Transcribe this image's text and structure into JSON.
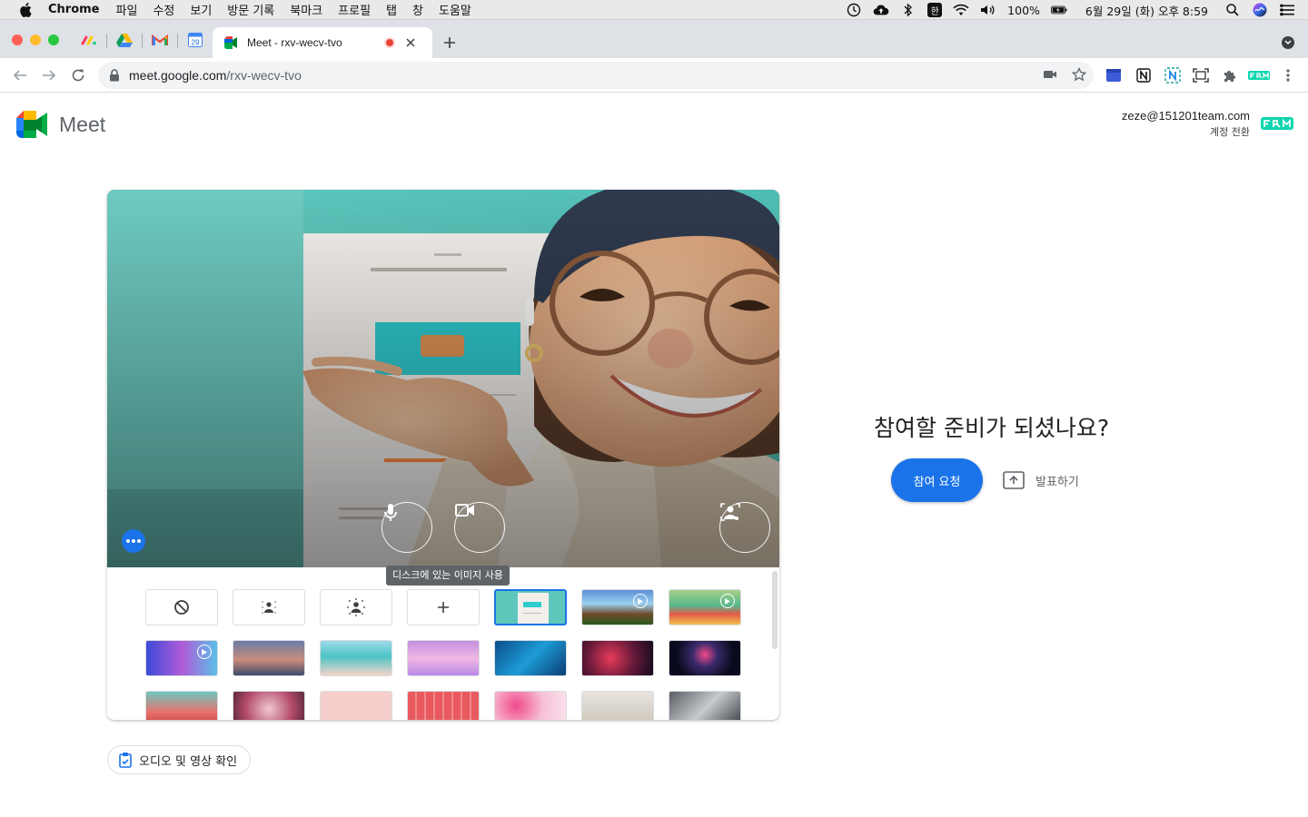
{
  "menubar": {
    "app_name": "Chrome",
    "items": [
      "파일",
      "수정",
      "보기",
      "방문 기록",
      "북마크",
      "프로필",
      "탭",
      "창",
      "도움말"
    ],
    "ime": "한",
    "battery": "100%",
    "datetime": "6월 29일 (화) 오후 8:59"
  },
  "browser": {
    "active_tab_title": "Meet - rxv-wecv-tvo",
    "url_domain": "meet.google.com",
    "url_path": "/rxv-wecv-tvo",
    "pinned_tabs": [
      "monday-icon",
      "google-drive-icon",
      "gmail-icon",
      "google-calendar-icon"
    ],
    "calendar_day": "29"
  },
  "meet": {
    "logo_text": "Meet",
    "account_email": "zeze@151201team.com",
    "switch_account": "계정 전환",
    "ready_title": "참여할 준비가 되셨나요?",
    "join_button": "참여 요청",
    "present_button": "발표하기",
    "audio_video_check": "오디오 및 영상 확인",
    "tooltip": "디스크에 있는 이미지 사용"
  },
  "colors": {
    "accent": "#1a73e8",
    "video_bg": "#5fc6bc"
  }
}
